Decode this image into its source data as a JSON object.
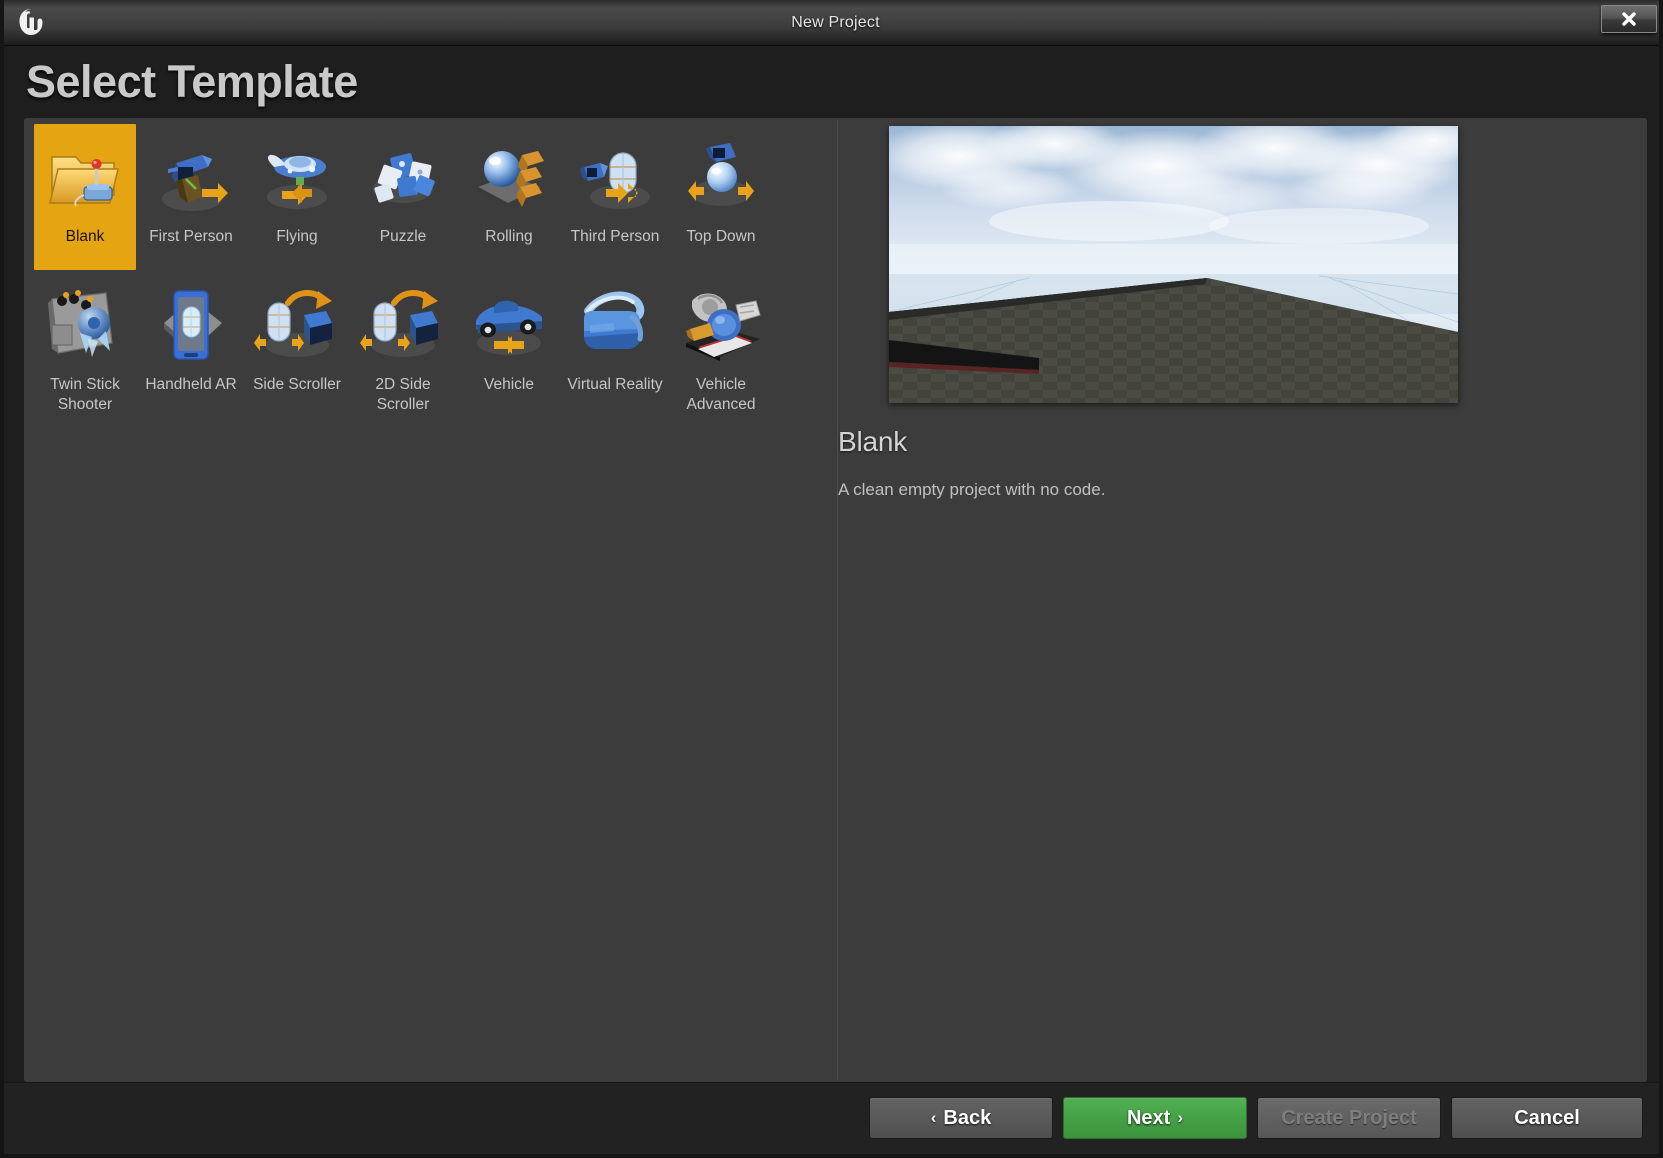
{
  "window": {
    "title": "New Project",
    "logo_glyph": "U",
    "close_label": "close-window"
  },
  "heading": "Select Template",
  "templates": {
    "selected_index": 0,
    "items": [
      {
        "label": "Blank",
        "icon": "blank-folder-joystick-icon",
        "selected": true
      },
      {
        "label": "First Person",
        "icon": "first-person-gun-icon",
        "selected": false
      },
      {
        "label": "Flying",
        "icon": "flying-ship-icon",
        "selected": false
      },
      {
        "label": "Puzzle",
        "icon": "puzzle-pieces-icon",
        "selected": false
      },
      {
        "label": "Rolling",
        "icon": "rolling-ball-blocks-icon",
        "selected": false
      },
      {
        "label": "Third Person",
        "icon": "third-person-capsule-icon",
        "selected": false
      },
      {
        "label": "Top Down",
        "icon": "top-down-sphere-icon",
        "selected": false
      },
      {
        "label": "Twin Stick Shooter",
        "icon": "twin-stick-shooter-icon",
        "selected": false
      },
      {
        "label": "Handheld AR",
        "icon": "handheld-ar-phone-icon",
        "selected": false
      },
      {
        "label": "Side Scroller",
        "icon": "side-scroller-icon",
        "selected": false
      },
      {
        "label": "2D Side Scroller",
        "icon": "2d-side-scroller-icon",
        "selected": false
      },
      {
        "label": "Vehicle",
        "icon": "vehicle-car-icon",
        "selected": false
      },
      {
        "label": "Virtual Reality",
        "icon": "virtual-reality-headset-icon",
        "selected": false
      },
      {
        "label": "Vehicle Advanced",
        "icon": "vehicle-advanced-icon",
        "selected": false
      }
    ]
  },
  "detail": {
    "title": "Blank",
    "description": "A clean empty project with no code.",
    "preview_alt": "blank-template-preview"
  },
  "footer": {
    "back_label": "Back",
    "back_chevron": "‹",
    "next_label": "Next",
    "next_chevron": "›",
    "create_label": "Create Project",
    "cancel_label": "Cancel"
  },
  "colors": {
    "selection": "#e5a412",
    "primary_button": "#45a145",
    "panel": "#3c3c3c",
    "window_bg": "#1e1e1e"
  }
}
